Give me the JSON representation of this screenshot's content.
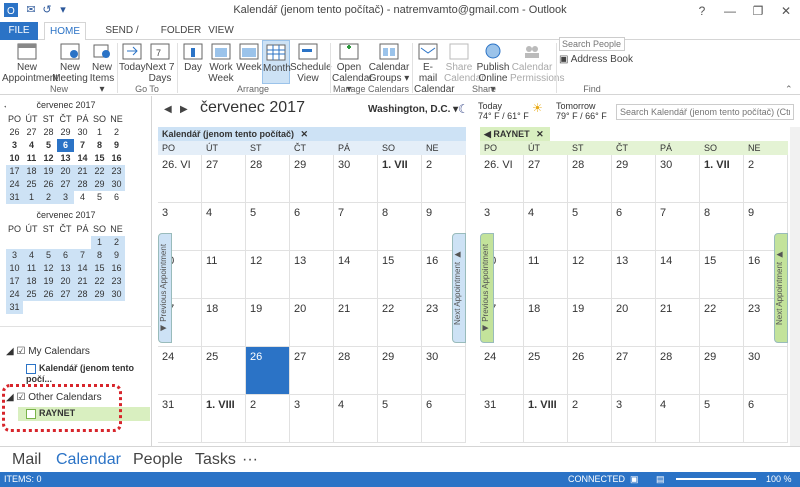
{
  "window": {
    "title": "Kalendář (jenom tento počítač) - natremvamto@gmail.com - Outlook",
    "help": "?",
    "minimize": "—",
    "restore": "❐",
    "close": "✕"
  },
  "quick_access": [
    "✉",
    "↺",
    "▾"
  ],
  "tabs": [
    "FILE",
    "HOME",
    "SEND / RECEIVE",
    "FOLDER",
    "VIEW"
  ],
  "ribbon": {
    "new": [
      {
        "label": "New Appointment"
      },
      {
        "label": "New Meeting"
      },
      {
        "label": "New Items ▾"
      }
    ],
    "goto": [
      {
        "label": "Today"
      },
      {
        "label": "Next 7 Days"
      }
    ],
    "arrange": [
      {
        "label": "Day"
      },
      {
        "label": "Work Week"
      },
      {
        "label": "Week"
      },
      {
        "label": "Month"
      },
      {
        "label": "Schedule View"
      }
    ],
    "manage": [
      {
        "label": "Open Calendar ▾"
      },
      {
        "label": "Calendar Groups ▾"
      }
    ],
    "share": [
      {
        "label": "E-mail Calendar"
      },
      {
        "label": "Share Calendar"
      },
      {
        "label": "Publish Online ▾"
      },
      {
        "label": "Calendar Permissions"
      }
    ],
    "find": {
      "placeholder": "Search People",
      "address_book": "Address Book"
    },
    "groups": {
      "new": "New",
      "goto": "Go To",
      "arrange": "Arrange",
      "manage": "Manage Calendars",
      "share": "Share",
      "find": "Find"
    }
  },
  "left": {
    "minical1": {
      "title": "červenec 2017",
      "prev": "◀",
      "days": [
        "PO",
        "ÚT",
        "ST",
        "ČT",
        "PÁ",
        "SO",
        "NE"
      ]
    },
    "minical2": {
      "title": "červenec 2017",
      "days": [
        "PO",
        "ÚT",
        "ST",
        "ČT",
        "PÁ",
        "SO",
        "NE"
      ]
    },
    "groups": [
      {
        "label": "My Calendars"
      },
      {
        "label": "Kalendář (jenom tento počí..."
      },
      {
        "label": "Other Calendars"
      },
      {
        "label": "RAYNET"
      }
    ]
  },
  "header": {
    "prev": "◀",
    "next": "▶",
    "month": "červenec 2017",
    "location": "Washington, D.C. ▾",
    "today_label": "Today",
    "today_temp": "74° F / 61° F",
    "tomorrow_label": "Tomorrow",
    "tomorrow_temp": "79° F / 66° F",
    "search_placeholder": "Search Kalendář (jenom tento počítač) (Ctrl+E)"
  },
  "calendars": [
    {
      "tab": "Kalendář (jenom tento počítač)",
      "close": "✕"
    },
    {
      "tab": "RAYNET",
      "close": "✕"
    }
  ],
  "weekdays": [
    "PO",
    "ÚT",
    "ST",
    "ČT",
    "PÁ",
    "SO",
    "NE"
  ],
  "weeks": [
    [
      "26. VI",
      "27",
      "28",
      "29",
      "30",
      "1. VII",
      "2"
    ],
    [
      "3",
      "4",
      "5",
      "6",
      "7",
      "8",
      "9"
    ],
    [
      "10",
      "11",
      "12",
      "13",
      "14",
      "15",
      "16"
    ],
    [
      "17",
      "18",
      "19",
      "20",
      "21",
      "22",
      "23"
    ],
    [
      "24",
      "25",
      "26",
      "27",
      "28",
      "29",
      "30"
    ],
    [
      "31",
      "1. VIII",
      "2",
      "3",
      "4",
      "5",
      "6"
    ]
  ],
  "vtabs": {
    "prev": "Previous Appointment",
    "next": "Next Appointment"
  },
  "nav": {
    "mail": "Mail",
    "calendar": "Calendar",
    "people": "People",
    "tasks": "Tasks",
    "more": "···"
  },
  "status": {
    "items": "ITEMS: 0",
    "connected": "CONNECTED",
    "zoom": "100 %"
  },
  "colors": {
    "accent": "#2b73c6",
    "raynet": "#d9efc0"
  }
}
